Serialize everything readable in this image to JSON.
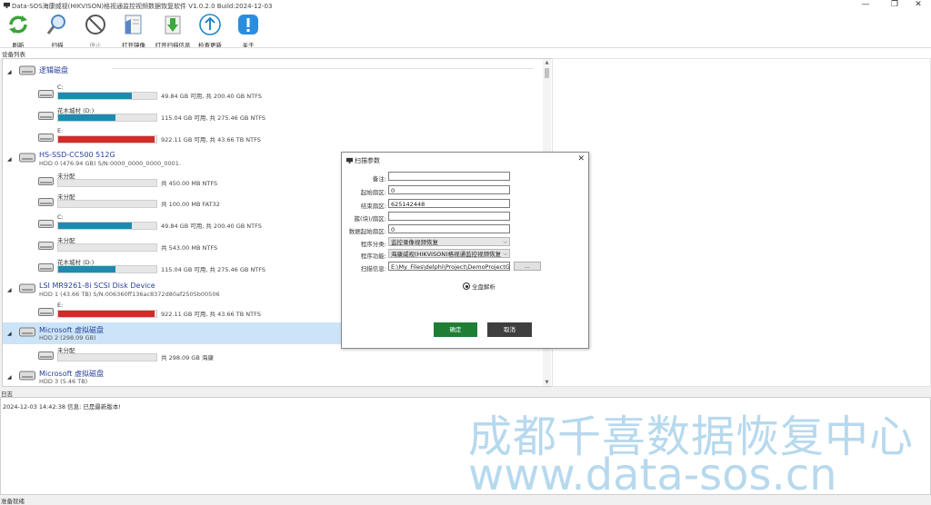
{
  "window": {
    "title": "Data-SOS海康威视(HIKVISON)格视通监控视频数据恢复软件 V1.0.2.0  Build:2024-12-03",
    "min": "—",
    "max": "❐",
    "close": "✕"
  },
  "toolbar": [
    {
      "label": "刷新",
      "icon": "refresh-icon"
    },
    {
      "label": "扫描",
      "icon": "search-icon"
    },
    {
      "label": "停止",
      "icon": "stop-icon"
    },
    {
      "label": "打开镜像",
      "icon": "open-image-icon"
    },
    {
      "label": "打开扫描信息",
      "icon": "open-scan-info-icon"
    },
    {
      "label": "检查更新",
      "icon": "update-icon"
    },
    {
      "label": "关于",
      "icon": "about-icon"
    }
  ],
  "tab": "设备列表",
  "devices": {
    "d1": {
      "name": "逻辑磁盘",
      "sub": "",
      "parts": [
        {
          "name": "C:",
          "info": "49.84 GB 可用, 共 200.40 GB NTFS",
          "fill": 0.75,
          "color": "#1c8bb0"
        },
        {
          "name": "花木城村 (D:)",
          "info": "115.04 GB 可用, 共 275.46 GB NTFS",
          "fill": 0.58,
          "color": "#1c8bb0"
        },
        {
          "name": "E:",
          "info": "922.11 GB 可用, 共 43.66 TB NTFS",
          "fill": 0.98,
          "color": "#d42a2a"
        }
      ]
    },
    "d2": {
      "name": "HS-SSD-CC500 512G",
      "sub": "HDD 0 (476.94 GB) S/N:0000_0000_0000_0001.",
      "parts": [
        {
          "name": "未分配",
          "info": "共 450.00 MB NTFS",
          "fill": 0,
          "color": "#1c8bb0"
        },
        {
          "name": "未分配",
          "info": "共 100.00 MB FAT32",
          "fill": 0,
          "color": "#1c8bb0"
        },
        {
          "name": "C:",
          "info": "49.84 GB 可用, 共 200.40 GB NTFS",
          "fill": 0.75,
          "color": "#1c8bb0"
        },
        {
          "name": "未分配",
          "info": "共 543.00 MB NTFS",
          "fill": 0,
          "color": "#1c8bb0"
        },
        {
          "name": "花木城村 (D:)",
          "info": "115.04 GB 可用, 共 275.46 GB NTFS",
          "fill": 0.58,
          "color": "#1c8bb0"
        }
      ]
    },
    "d3": {
      "name": "LSI MR9261-8i SCSI Disk Device",
      "sub": "HDD 1 (43.66 TB) S/N:006360ff136ac8372d80af2505b00506",
      "parts": [
        {
          "name": "E:",
          "info": "922.11 GB 可用, 共 43.66 TB NTFS",
          "fill": 0.98,
          "color": "#d42a2a"
        }
      ]
    },
    "d4": {
      "name": "Microsoft 虚拟磁盘",
      "sub": "HDD 2 (298.09 GB)",
      "parts": [
        {
          "name": "未分配",
          "info": "共 298.09 GB 海康",
          "fill": 0,
          "color": "#1c8bb0"
        }
      ]
    },
    "d5": {
      "name": "Microsoft 虚拟磁盘",
      "sub": "HDD 3 (5.46 TB)",
      "parts": []
    }
  },
  "log": {
    "label": "日志",
    "lines": [
      "2024-12-03 14:42:38 信息: 已是最新版本!"
    ]
  },
  "watermark": {
    "line1": "成都千喜数据恢复中心",
    "line2": "www.data-sos.cn"
  },
  "status": "准备就绪",
  "dialog": {
    "title": "扫描参数",
    "close": "✕",
    "fields": {
      "note": {
        "label": "备注:",
        "value": ""
      },
      "start": {
        "label": "起始扇区:",
        "value": "0"
      },
      "end": {
        "label": "结束扇区:",
        "value": "625142448"
      },
      "cluster": {
        "label": "簇(块)/扇区:",
        "value": ""
      },
      "data_start": {
        "label": "数据起始扇区:",
        "value": "0"
      },
      "category": {
        "label": "程序分类:",
        "value": "监控录像视频恢复"
      },
      "function": {
        "label": "程序功能:",
        "value": "海康威视(HIKVISON)格视通监控视频恢复"
      },
      "scan_info": {
        "label": "扫描信息:",
        "value": "E:\\My_Files\\delphi\\Project\\DemoProjectGro"
      }
    },
    "browse": "...",
    "radio": "全盘解析",
    "ok": "确定",
    "cancel": "取消"
  }
}
